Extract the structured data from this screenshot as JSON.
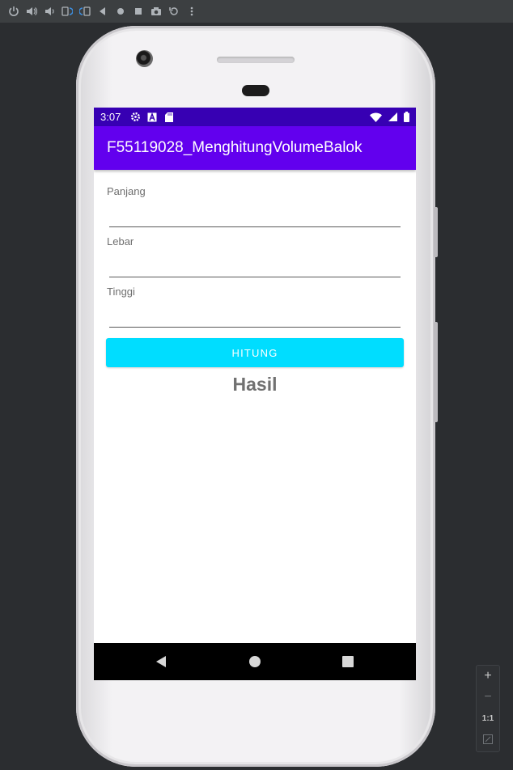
{
  "toolbar": {
    "icons": [
      "power-icon",
      "volume-up-icon",
      "volume-down-icon",
      "rotate-left-icon",
      "rotate-right-icon",
      "back-icon",
      "home-icon",
      "overview-icon",
      "camera-icon",
      "replay-icon",
      "more-icon"
    ]
  },
  "status_bar": {
    "time": "3:07",
    "icons": [
      "settings-icon",
      "a-icon",
      "sd-card-icon",
      "wifi-icon",
      "signal-icon",
      "battery-icon"
    ]
  },
  "app_bar": {
    "title": "F55119028_MenghitungVolumeBalok"
  },
  "form": {
    "panjang_label": "Panjang",
    "panjang_value": "",
    "lebar_label": "Lebar",
    "lebar_value": "",
    "tinggi_label": "Tinggi",
    "tinggi_value": "",
    "hitung_button": "HITUNG",
    "hasil_text": "Hasil"
  },
  "zoom": {
    "plus": "+",
    "minus": "−",
    "one_to_one": "1:1"
  },
  "colors": {
    "status_bar": "#3700b3",
    "app_bar": "#6200ee",
    "button": "#00ddff",
    "hasil_text": "#717171"
  }
}
